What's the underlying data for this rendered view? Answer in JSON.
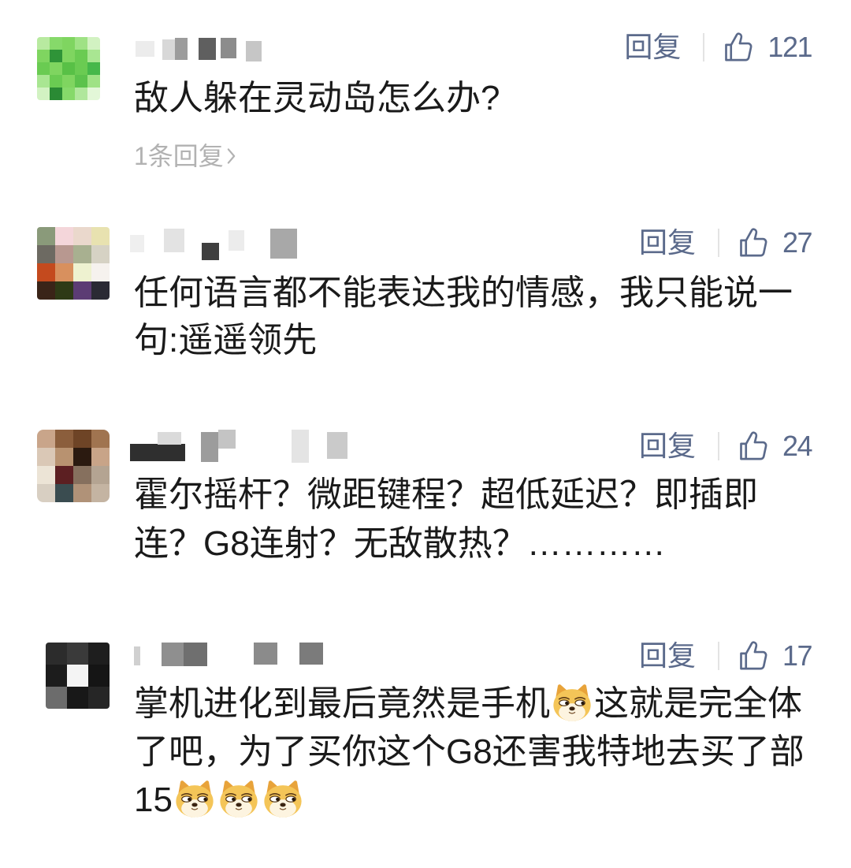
{
  "colors": {
    "background": "#ffffff",
    "text": "#1a1a1a",
    "link": "#5b6a8b",
    "muted": "#b2b2b2",
    "divider": "#e3e3e3"
  },
  "comments": [
    {
      "avatar_pixels": [
        [
          "#b8eaa0",
          "#86d96a",
          "#7fd560",
          "#9fe285",
          "#d2f2c2"
        ],
        [
          "#7fd560",
          "#2f9438",
          "#7fd560",
          "#6acb52",
          "#a9e692"
        ],
        [
          "#6acb52",
          "#7fd560",
          "#58c046",
          "#6acb52",
          "#46b84a"
        ],
        [
          "#a9e692",
          "#6acb52",
          "#7fd560",
          "#5cc24c",
          "#9fe285"
        ],
        [
          "#d2f2c2",
          "#2a8a34",
          "#86d96a",
          "#b0e79c",
          "#e3f7d8"
        ]
      ],
      "reply_label": "回复",
      "like_icon": "thumbs-up-icon",
      "like_count": "121",
      "lines": [
        [
          {
            "text": "敌人躲在灵动岛怎么办?"
          }
        ]
      ],
      "replies_link": {
        "label": "1条回复",
        "icon": "chevron-right-icon"
      }
    },
    {
      "avatar_pixels": [
        [
          "#8a9a7a",
          "#f4d6da",
          "#ead8cc",
          "#e8e2b0"
        ],
        [
          "#6d6a62",
          "#b89890",
          "#a8b090",
          "#d6d2c4"
        ],
        [
          "#c44a1e",
          "#d8905e",
          "#eef2d0",
          "#f6f2ee"
        ],
        [
          "#3a2418",
          "#2e3a16",
          "#5c3c74",
          "#2a2a34"
        ]
      ],
      "reply_label": "回复",
      "like_icon": "thumbs-up-icon",
      "like_count": "27",
      "lines": [
        [
          {
            "text": "任何语言都不能表达我的情感，我只能说一"
          }
        ],
        [
          {
            "text": "句:遥遥领先"
          }
        ]
      ]
    },
    {
      "avatar_pixels": [
        [
          "#c9a58a",
          "#8b5e3c",
          "#6e4426",
          "#a07450"
        ],
        [
          "#dac8b6",
          "#b89270",
          "#2b1a10",
          "#c8a488"
        ],
        [
          "#ece4d6",
          "#5c1f22",
          "#86705e",
          "#b4a492"
        ],
        [
          "#d8cfc2",
          "#3a4c50",
          "#b09278",
          "#c4b4a2"
        ]
      ],
      "reply_label": "回复",
      "like_icon": "thumbs-up-icon",
      "like_count": "24",
      "lines": [
        [
          {
            "text": "霍尔摇杆？微距键程？超低延迟？即插即"
          }
        ],
        [
          {
            "text": "连？G8连射？无敌散热？…………"
          }
        ]
      ]
    },
    {
      "avatar_pixels": [
        [
          "#2c2c2c",
          "#3a3a3a",
          "#1e1e1e"
        ],
        [
          "#1c1c1c",
          "#f4f4f4",
          "#151515"
        ],
        [
          "#6c6c6c",
          "#181818",
          "#262626"
        ]
      ],
      "reply_label": "回复",
      "like_icon": "thumbs-up-icon",
      "like_count": "17",
      "lines": [
        [
          {
            "text": "掌机进化到最后竟然是手机"
          },
          {
            "emoji": "doge-emoji"
          },
          {
            "text": "这就是完全体"
          }
        ],
        [
          {
            "text": "了吧，为了买你这个G8还害我特地去买了部"
          }
        ],
        [
          {
            "text": "15"
          },
          {
            "emoji": "doge-emoji"
          },
          {
            "emoji": "doge-emoji"
          },
          {
            "emoji": "doge-emoji"
          }
        ]
      ]
    }
  ]
}
